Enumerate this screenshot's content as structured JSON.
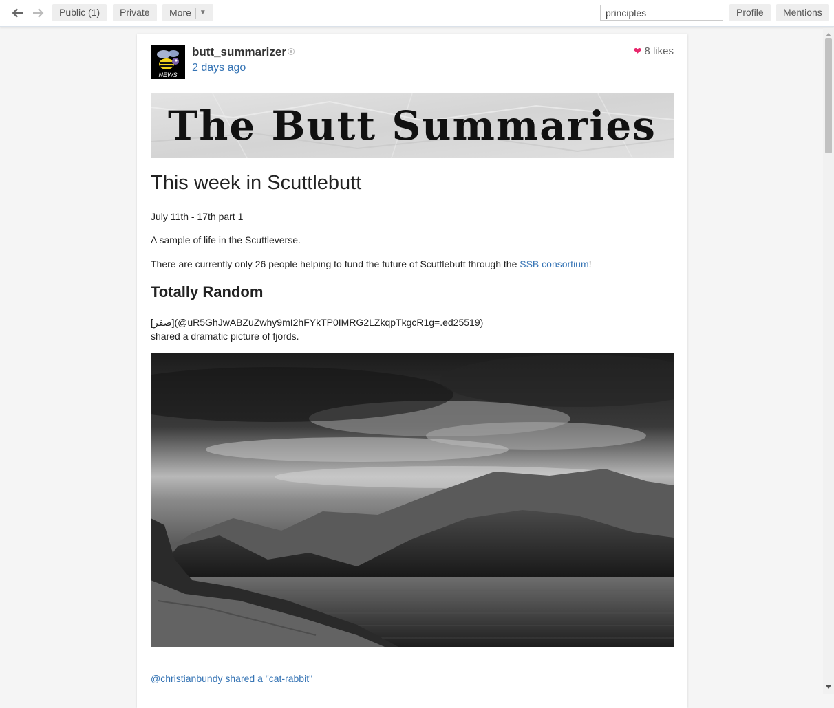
{
  "toolbar": {
    "tabs": [
      {
        "label": "Public (1)"
      },
      {
        "label": "Private"
      },
      {
        "label": "More"
      }
    ],
    "search": {
      "value": "principles"
    },
    "right_buttons": [
      {
        "label": "Profile"
      },
      {
        "label": "Mentions"
      }
    ]
  },
  "post": {
    "author": "butt_summarizer",
    "timestamp": "2 days ago",
    "likes": "8 likes",
    "banner_title": "The Butt Summaries",
    "avatar_label": "NEWS",
    "title": "This week in Scuttlebutt",
    "dates": "July 11th - 17th part 1",
    "intro": "A sample of life in the Scuttleverse.",
    "funding_before": "There are currently only 26 people helping to fund the future of Scuttlebutt through the ",
    "funding_link": "SSB consortium",
    "funding_after": "!",
    "section_heading": "Totally Random",
    "mention_line": "[صفر](@uR5GhJwABZuZwhy9mI2hFYkTP0IMRG2LZkqpTkgcR1g=.ed25519)",
    "mention_desc": "shared a dramatic picture of fjords.",
    "footer_user": "@christianbundy",
    "footer_link": "shared a \"cat-rabbit\""
  },
  "colors": {
    "link": "#3473b4",
    "heart": "#e8286c",
    "background": "#f5f5f5"
  },
  "icons": [
    "back-arrow-icon",
    "forward-arrow-icon",
    "heart-icon",
    "chevron-down-icon",
    "status-dot-icon"
  ]
}
